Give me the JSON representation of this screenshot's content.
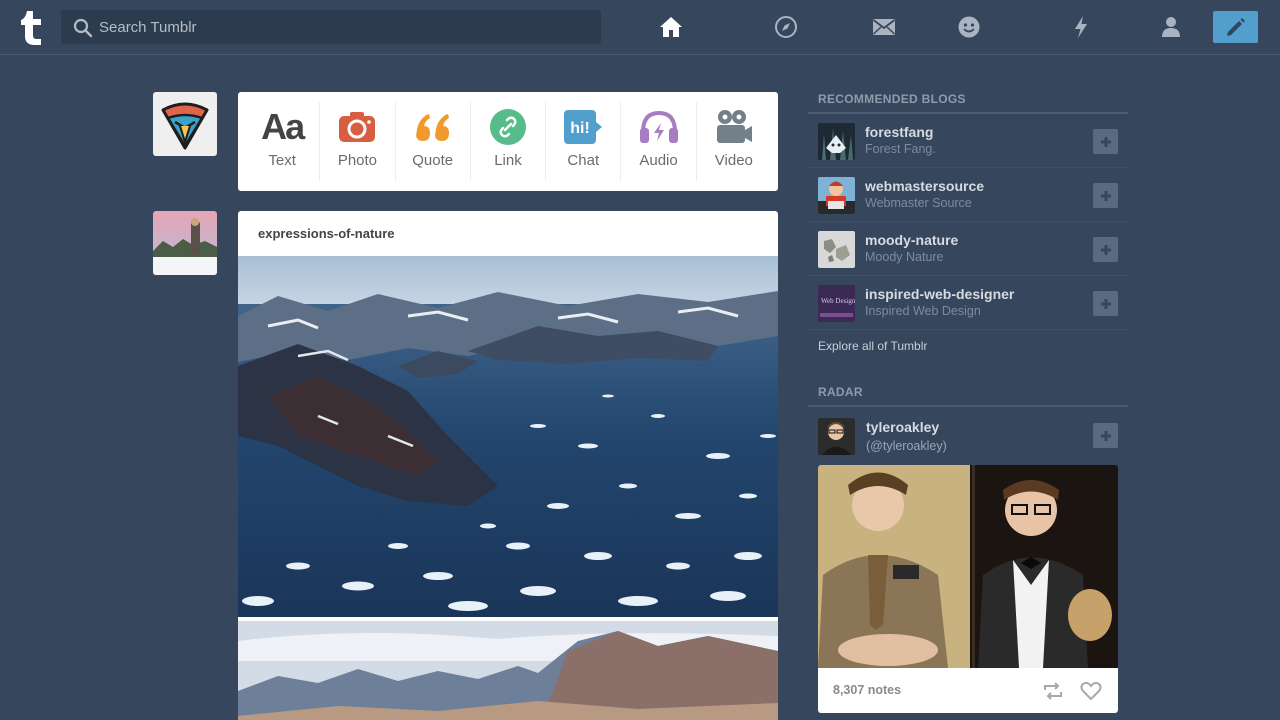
{
  "header": {
    "search_placeholder": "Search Tumblr",
    "nav_icons": [
      "home-icon",
      "compass-icon",
      "mail-icon",
      "smiley-icon",
      "lightning-icon",
      "account-icon"
    ],
    "compose_icon": "pencil-icon",
    "accent_color": "#529ecc"
  },
  "post_types": [
    {
      "label": "Text",
      "icon": "text-icon",
      "color": "#444444"
    },
    {
      "label": "Photo",
      "icon": "camera-icon",
      "color": "#d95e40"
    },
    {
      "label": "Quote",
      "icon": "quote-icon",
      "color": "#f2992e"
    },
    {
      "label": "Link",
      "icon": "link-icon",
      "color": "#56bc8a"
    },
    {
      "label": "Chat",
      "icon": "chat-icon",
      "color": "#529ecc"
    },
    {
      "label": "Audio",
      "icon": "headphones-icon",
      "color": "#a77dc2"
    },
    {
      "label": "Video",
      "icon": "video-camera-icon",
      "color": "#748089"
    }
  ],
  "post": {
    "blog_name": "expressions-of-nature"
  },
  "sidebar": {
    "recommended_title": "RECOMMENDED BLOGS",
    "recommended": [
      {
        "name": "forestfang",
        "title": "Forest Fang."
      },
      {
        "name": "webmastersource",
        "title": "Webmaster Source"
      },
      {
        "name": "moody-nature",
        "title": "Moody Nature"
      },
      {
        "name": "inspired-web-designer",
        "title": "Inspired Web Design"
      }
    ],
    "explore_label": "Explore all of Tumblr",
    "radar_title": "RADAR",
    "radar": {
      "name": "tyleroakley",
      "handle": "(@tyleroakley)",
      "notes": "8,307 notes",
      "thumb_text": "Web Design"
    }
  }
}
